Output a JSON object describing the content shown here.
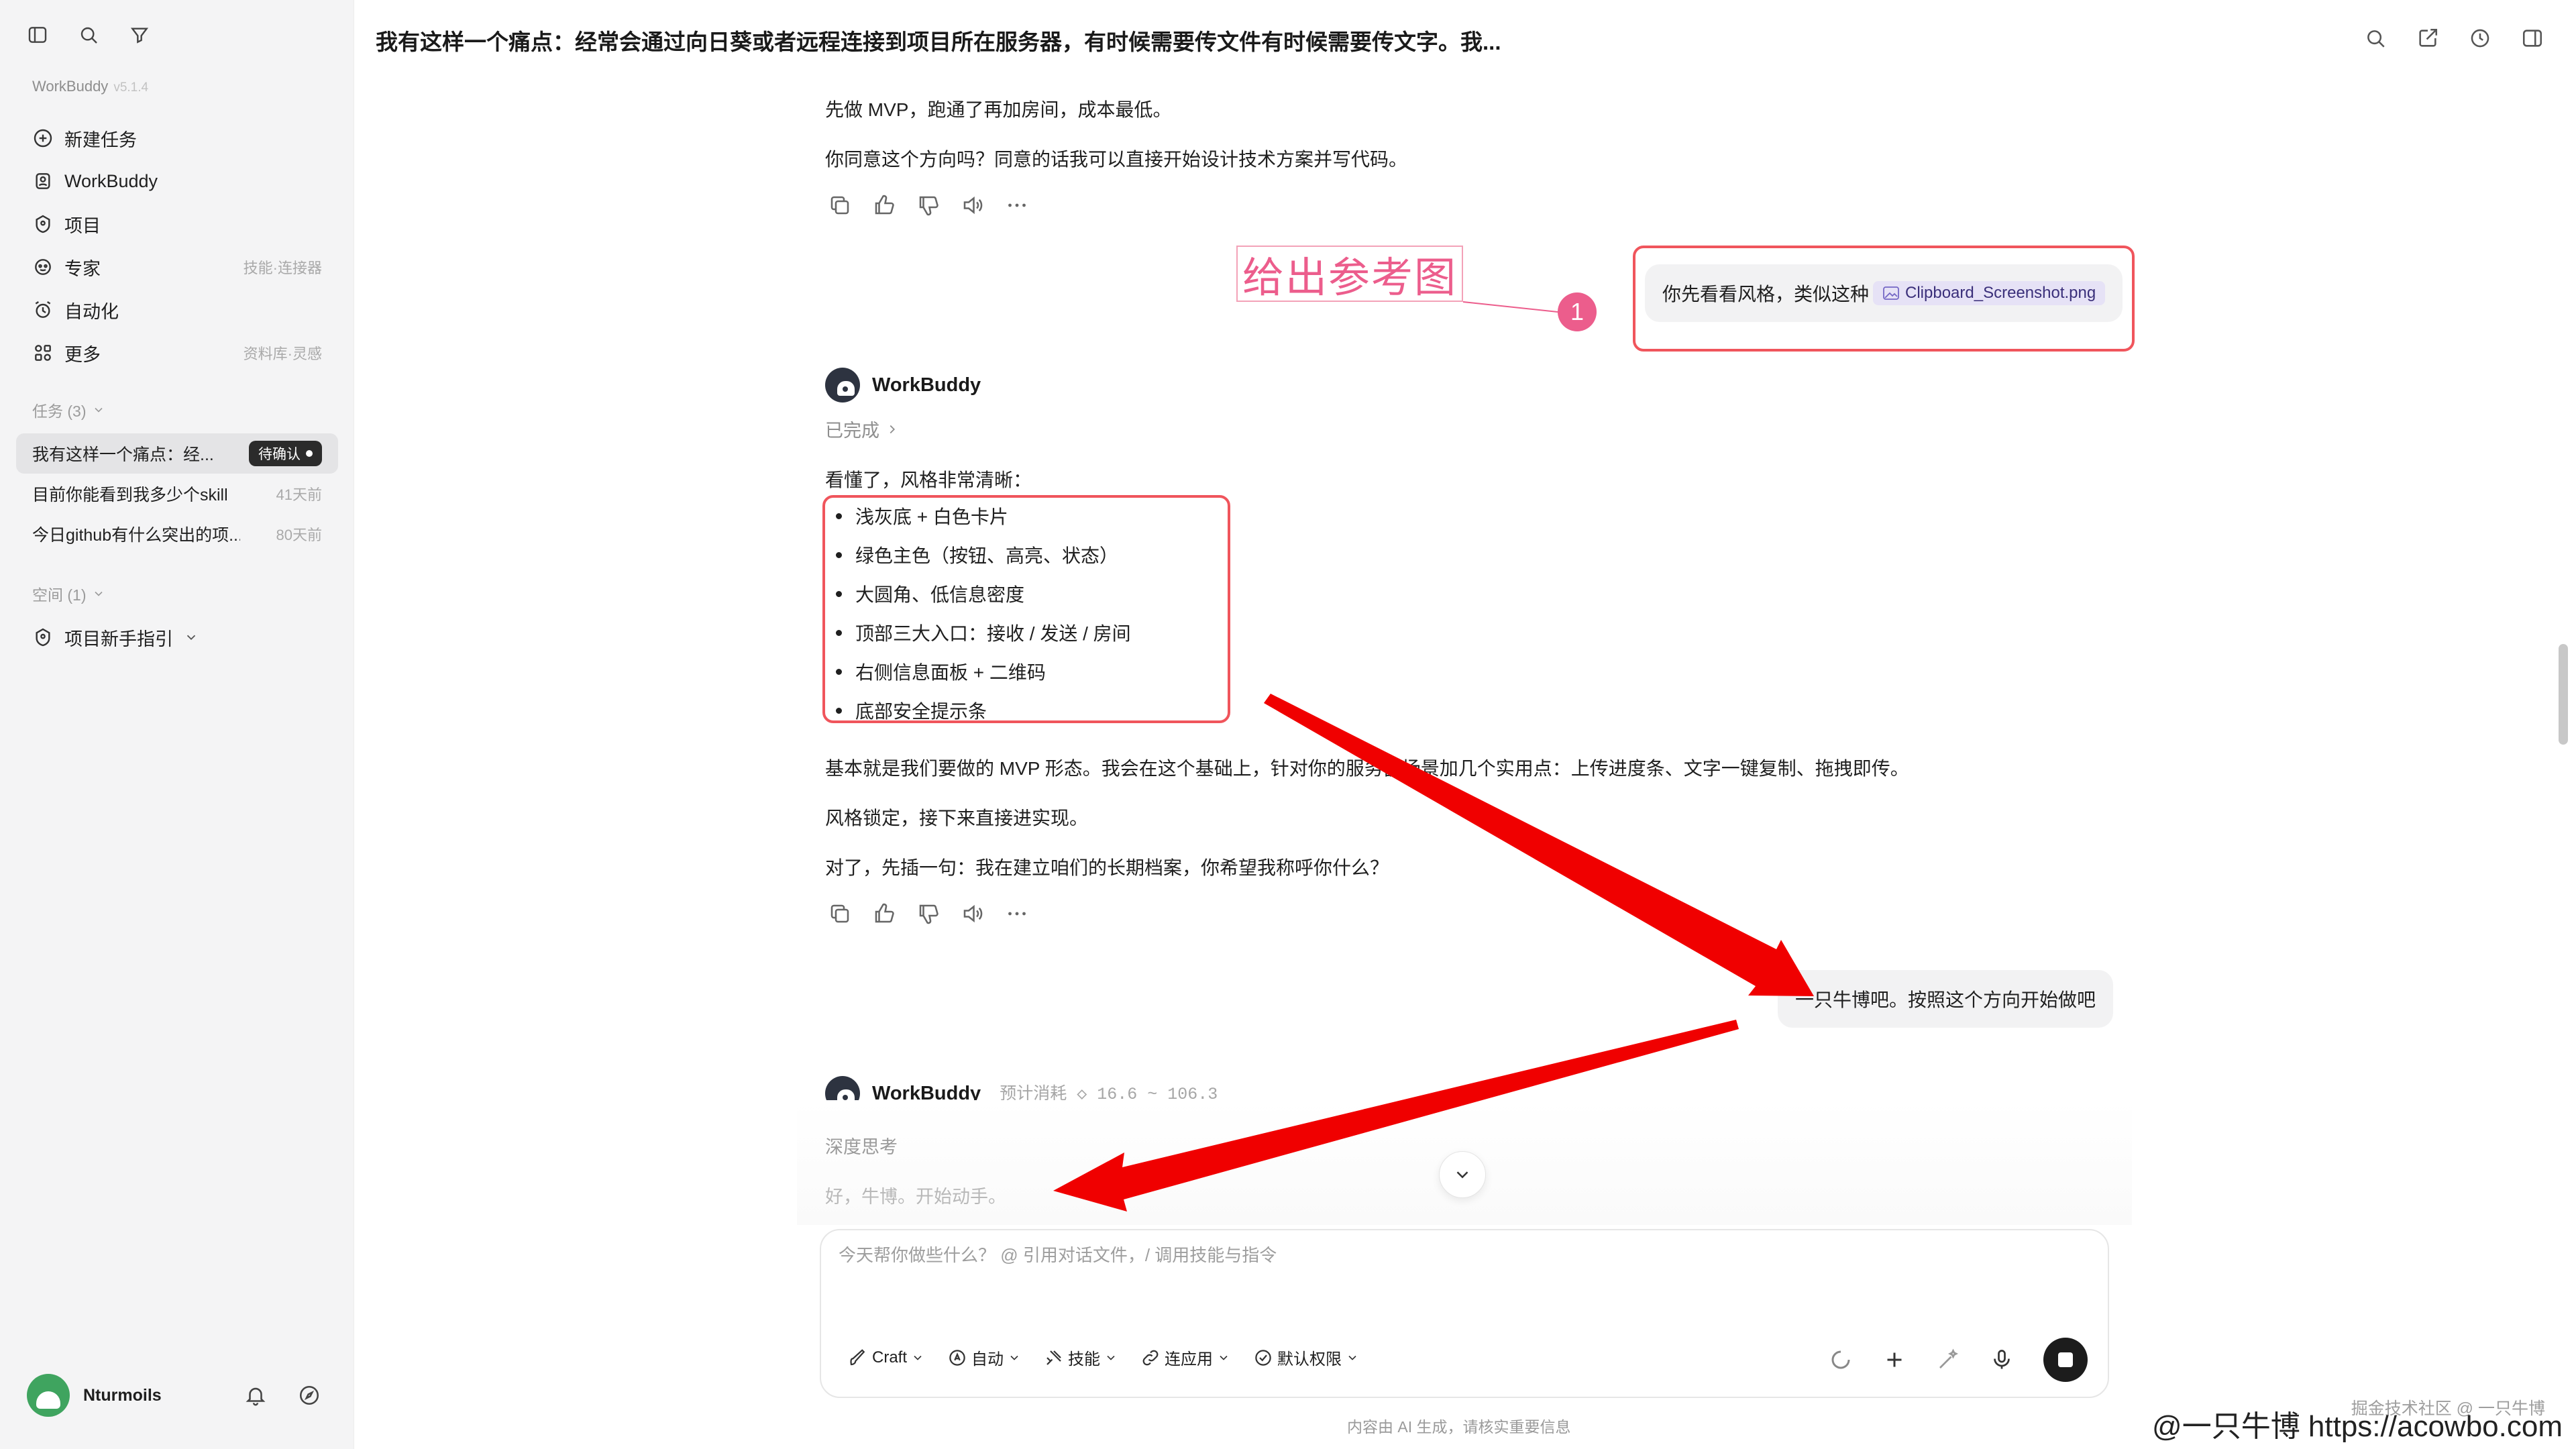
{
  "app": {
    "name": "WorkBuddy",
    "version": "v5.1.4"
  },
  "sidebar": {
    "nav": [
      {
        "label": "新建任务",
        "icon": "plus-circle-icon",
        "hint": ""
      },
      {
        "label": "WorkBuddy",
        "icon": "bot-icon",
        "hint": ""
      },
      {
        "label": "项目",
        "icon": "project-icon",
        "hint": ""
      },
      {
        "label": "专家",
        "icon": "expert-icon",
        "hint": "技能·连接器"
      },
      {
        "label": "自动化",
        "icon": "alarm-icon",
        "hint": ""
      },
      {
        "label": "更多",
        "icon": "grid-icon",
        "hint": "资料库·灵感"
      }
    ],
    "tasks_label": "任务 (3)",
    "tasks": [
      {
        "label": "我有这样一个痛点：经...",
        "meta": "待确认"
      },
      {
        "label": "目前你能看到我多少个skill",
        "meta": "41天前"
      },
      {
        "label": "今日github有什么突出的项...",
        "meta": "80天前"
      }
    ],
    "space_label": "空间 (1)",
    "space_item": "项目新手指引",
    "user": {
      "name": "Nturmoils"
    }
  },
  "header": {
    "title": "我有这样一个痛点：经常会通过向日葵或者远程连接到项目所在服务器，有时候需要传文件有时候需要传文字。我..."
  },
  "chat": {
    "intro_lines": [
      "先做 MVP，跑通了再加房间，成本最低。",
      "你同意这个方向吗？同意的话我可以直接开始设计技术方案并写代码。"
    ],
    "user_msg_1": "你先看看风格，类似这种",
    "attachment": "Clipboard_Screenshot.png",
    "bot_name": "WorkBuddy",
    "status_done": "已完成",
    "reply_intro": "看懂了，风格非常清晰：",
    "bullets": [
      "浅灰底 + 白色卡片",
      "绿色主色（按钮、高亮、状态）",
      "大圆角、低信息密度",
      "顶部三大入口：接收 / 发送 / 房间",
      "右侧信息面板 + 二维码",
      "底部安全提示条"
    ],
    "reply_lines": [
      "基本就是我们要做的 MVP 形态。我会在这个基础上，针对你的服务器场景加几个实用点：上传进度条、文字一键复制、拖拽即传。",
      "风格锁定，接下来直接进实现。",
      "对了，先插一句：我在建立咱们的长期档案，你希望我称呼你什么？"
    ],
    "user_msg_2": "一只牛博吧。按照这个方向开始做吧",
    "cost_estimate": "预计消耗 ◇ 16.6 ~ 106.3",
    "thinking_label": "深度思考",
    "thinking_text": "好，牛博。开始动手。"
  },
  "composer": {
    "placeholder": "今天帮你做些什么？ @ 引用对话文件，/ 调用技能与指令",
    "tools": [
      {
        "label": "Craft",
        "icon": "brush-icon"
      },
      {
        "label": "自动",
        "icon": "auto-icon"
      },
      {
        "label": "技能",
        "icon": "skill-icon"
      },
      {
        "label": "连应用",
        "icon": "link-icon"
      },
      {
        "label": "默认权限",
        "icon": "shield-check-icon"
      }
    ],
    "disclaimer": "内容由 AI 生成，请核实重要信息"
  },
  "annotations": {
    "note": "给出参考图",
    "step_number": "1"
  },
  "watermarks": {
    "small": "掘金技术社区 @ 一只牛博",
    "large": "@一只牛博 https://acowbo.com"
  },
  "colors": {
    "annotation_red": "#f0555c",
    "annotation_pink": "#ec5d8c",
    "arrow_red": "#f00000",
    "sidebar_bg": "#f4f4f5",
    "chip_bg": "#e6e2f6"
  }
}
